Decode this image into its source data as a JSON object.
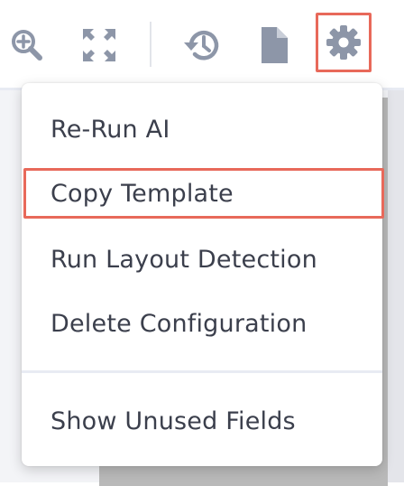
{
  "toolbar": {
    "icons": [
      {
        "name": "zoom-in-icon"
      },
      {
        "name": "fullscreen-icon"
      },
      {
        "name": "history-icon"
      },
      {
        "name": "document-icon"
      },
      {
        "name": "gear-icon"
      }
    ],
    "icon_color": "#8d96a8",
    "highlight_color": "#e8695a"
  },
  "menu": {
    "items": [
      {
        "label": "Re-Run AI"
      },
      {
        "label": "Copy Template"
      },
      {
        "label": "Run Layout Detection"
      },
      {
        "label": "Delete Configuration"
      },
      {
        "label": "Show Unused Fields"
      }
    ]
  }
}
